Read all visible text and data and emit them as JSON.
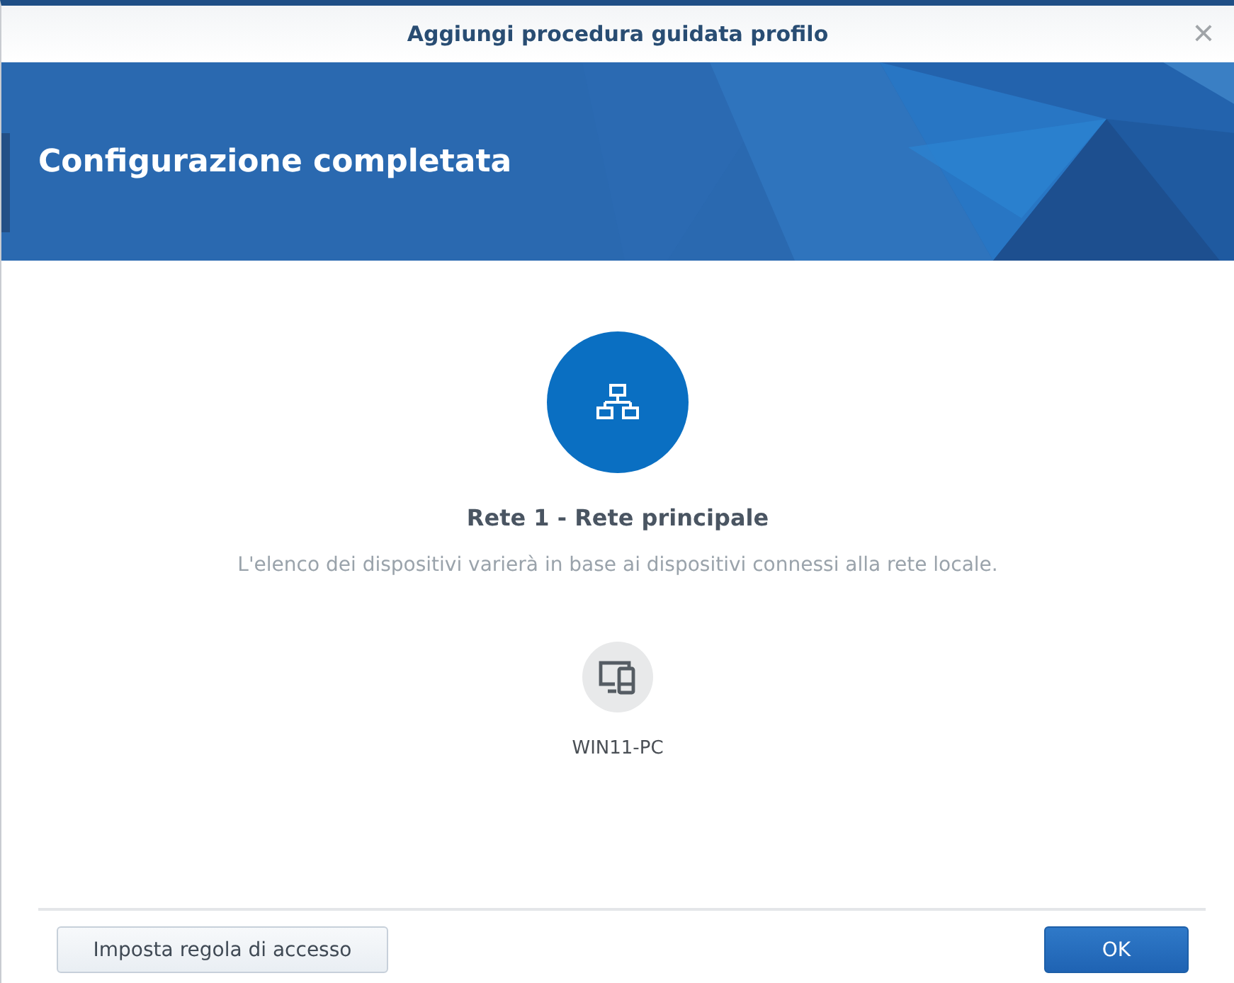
{
  "window": {
    "title": "Aggiungi procedura guidata profilo",
    "close": "×"
  },
  "banner": {
    "title": "Configurazione completata"
  },
  "network": {
    "name": "Rete 1 - Rete principale",
    "description": "L'elenco dei dispositivi varierà in base ai dispositivi connessi alla rete locale."
  },
  "devices": [
    {
      "name": "WIN11-PC"
    }
  ],
  "buttons": [
    {
      "label": "Imposta regola di accesso",
      "kind": "secondary"
    },
    {
      "label": "OK",
      "kind": "primary"
    }
  ]
}
